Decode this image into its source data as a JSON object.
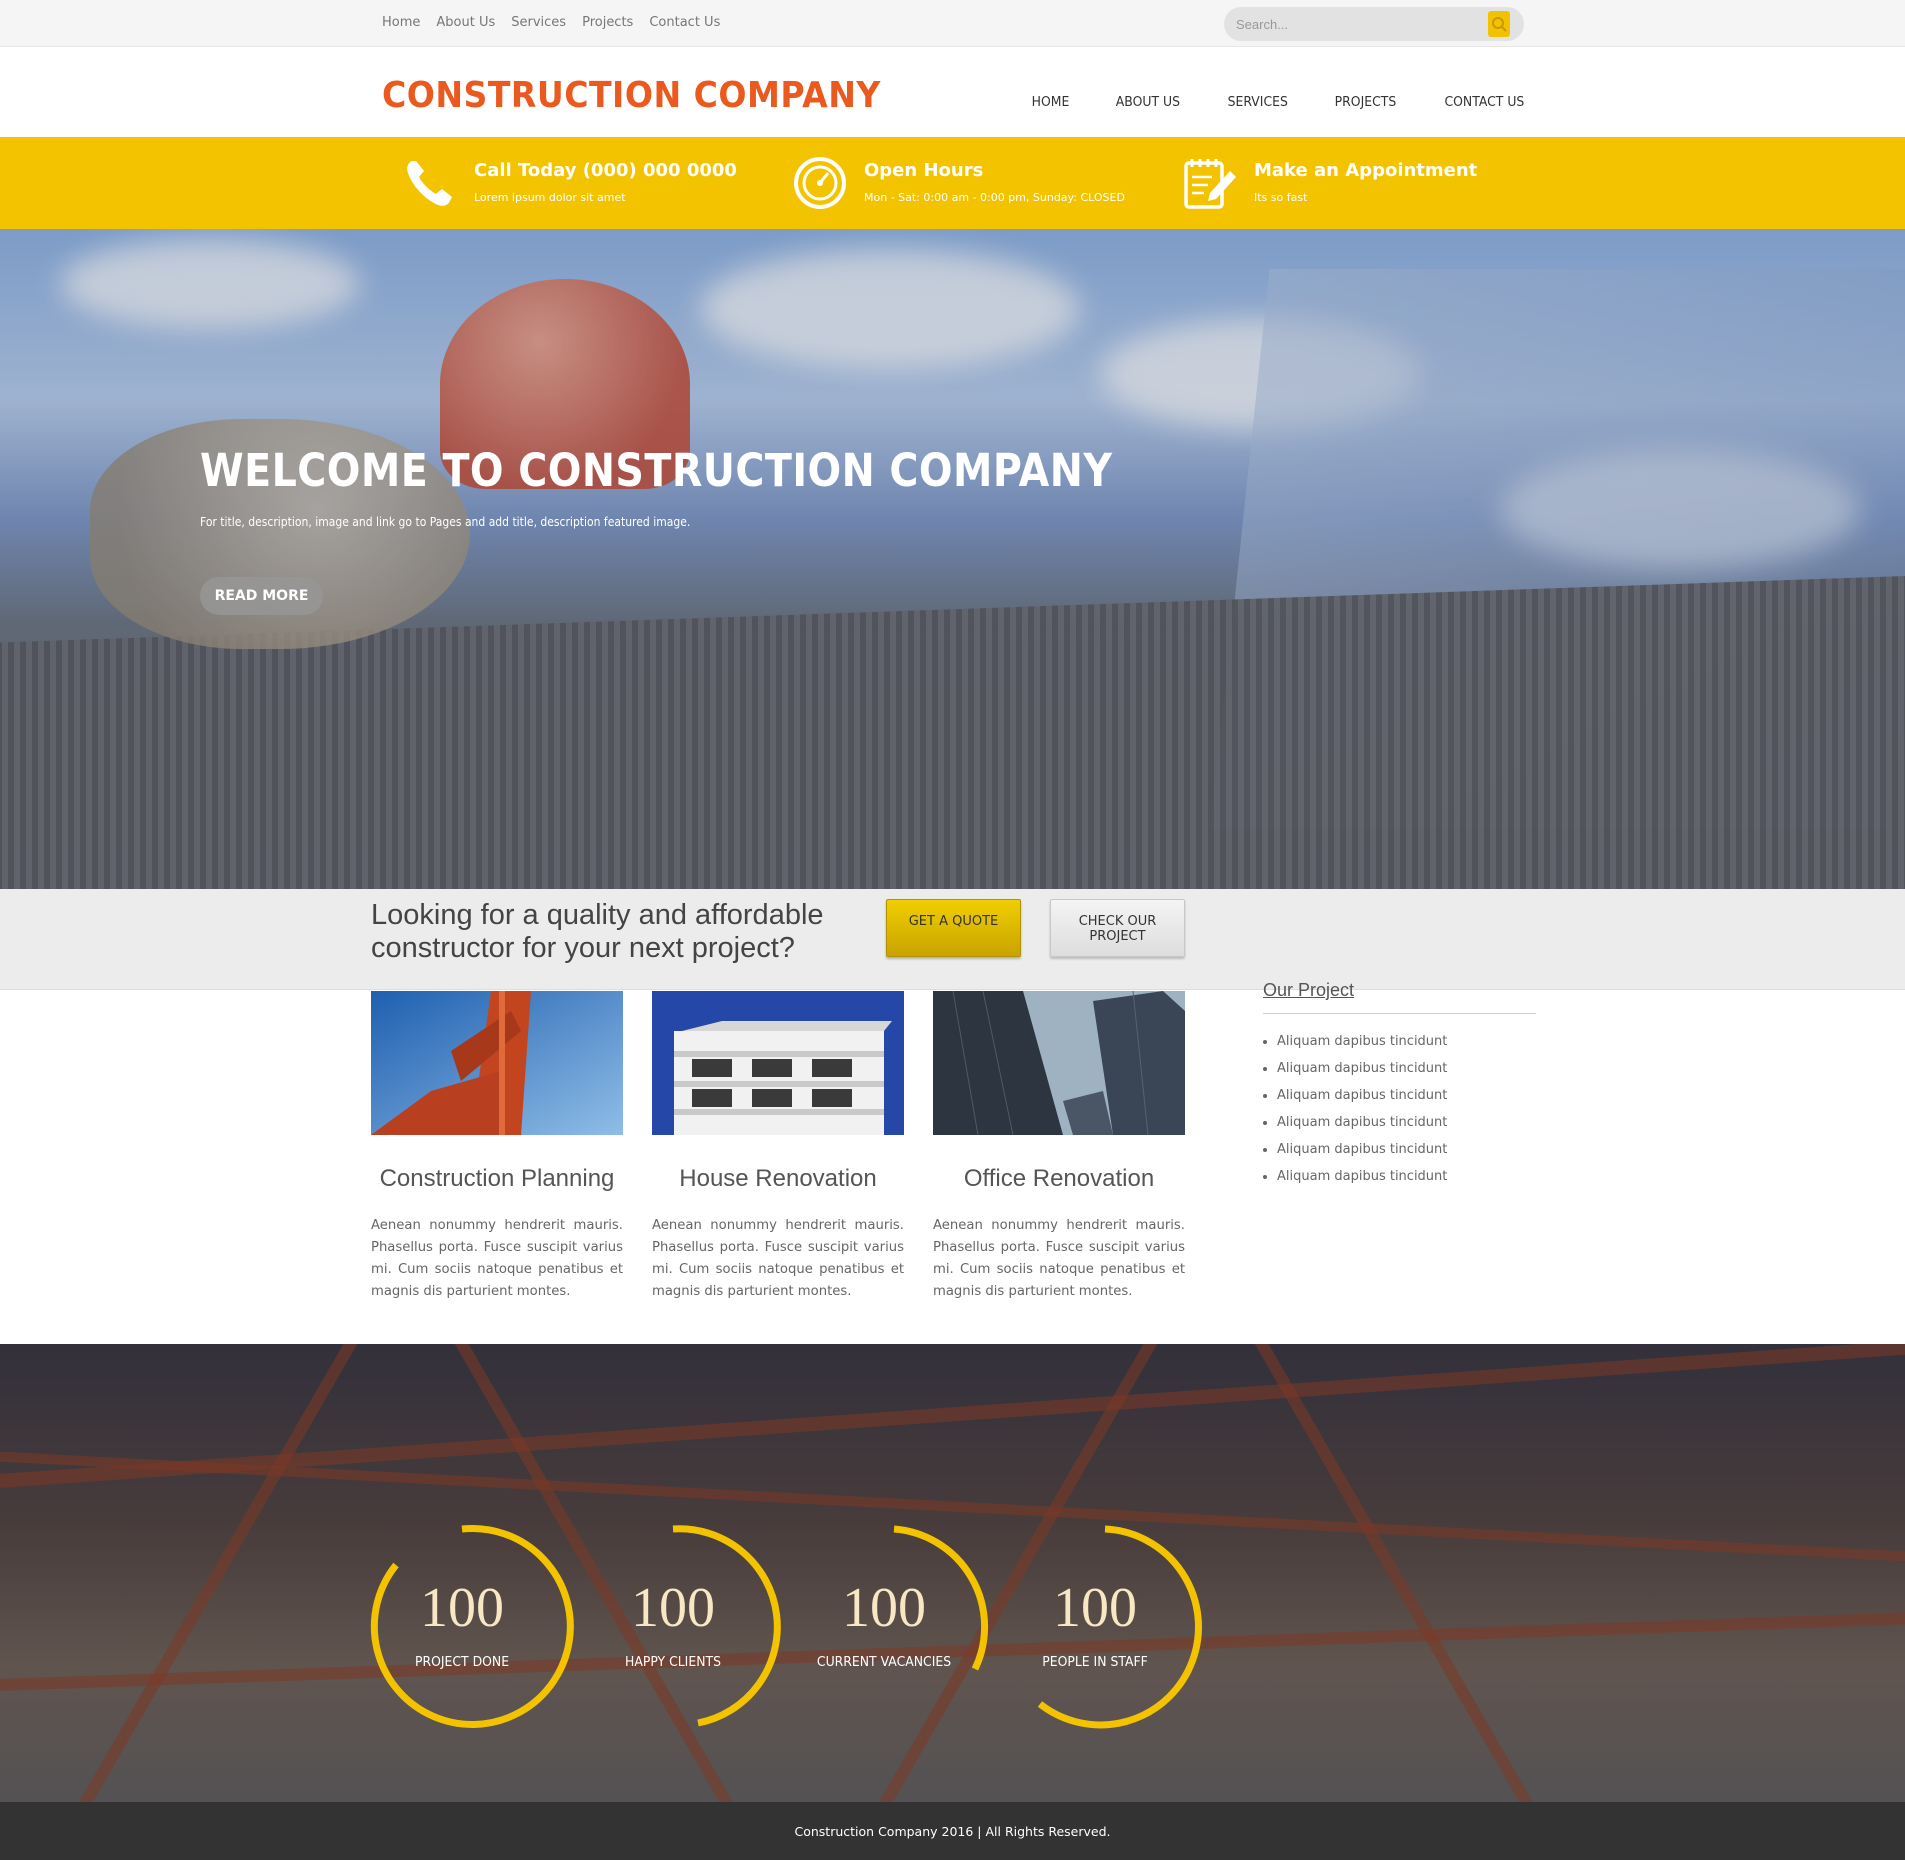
{
  "topbar": {
    "links": [
      "Home",
      "About Us",
      "Services",
      "Projects",
      "Contact Us"
    ],
    "search_placeholder": "Search...",
    "search_icon": "search-icon",
    "accent": "#f3c300"
  },
  "header": {
    "logo": "CONSTRUCTION COMPANY",
    "logo_color": "#ea5a1f",
    "nav": [
      "HOME",
      "ABOUT US",
      "SERVICES",
      "PROJECTS",
      "CONTACT US"
    ]
  },
  "infobar": {
    "items": [
      {
        "icon": "phone-icon",
        "title": "Call Today (000) 000 0000",
        "subtitle": "Lorem ipsum dolor sit amet"
      },
      {
        "icon": "clock-gauge-icon",
        "title": "Open Hours",
        "subtitle": "Mon - Sat: 0:00 am - 0:00 pm, Sunday: CLOSED"
      },
      {
        "icon": "notepad-pencil-icon",
        "title": "Make an Appointment",
        "subtitle": "Its so fast"
      }
    ]
  },
  "hero": {
    "title": "WELCOME TO CONSTRUCTION COMPANY",
    "text": "For title, description, image and link go to Pages and add title, description featured image.",
    "button": "READ MORE"
  },
  "cta": {
    "text": "Looking for a quality and affordable constructor for your next project?",
    "quote_button": "GET A QUOTE",
    "project_button": "CHECK OUR PROJECT"
  },
  "services": [
    {
      "image": "bridge-photo",
      "title": "Construction Planning",
      "text": "Aenean nonummy hendrerit mauris. Phasellus porta. Fusce suscipit varius mi. Cum sociis natoque penatibus et magnis dis parturient montes."
    },
    {
      "image": "house-photo",
      "title": "House Renovation",
      "text": "Aenean nonummy hendrerit mauris. Phasellus porta. Fusce suscipit varius mi. Cum sociis natoque penatibus et magnis dis parturient montes."
    },
    {
      "image": "office-towers-photo",
      "title": "Office Renovation",
      "text": "Aenean nonummy hendrerit mauris. Phasellus porta. Fusce suscipit varius mi. Cum sociis natoque penatibus et magnis dis parturient montes."
    }
  ],
  "sidebar": {
    "title": "Our Project",
    "items": [
      "Aliquam dapibus tincidunt",
      "Aliquam dapibus tincidunt",
      "Aliquam dapibus tincidunt",
      "Aliquam dapibus tincidunt",
      "Aliquam dapibus tincidunt",
      "Aliquam dapibus tincidunt"
    ]
  },
  "stats": [
    {
      "value": "100",
      "label": "PROJECT DONE"
    },
    {
      "value": "100",
      "label": "HAPPY CLIENTS"
    },
    {
      "value": "100",
      "label": "CURRENT VACANCIES"
    },
    {
      "value": "100",
      "label": "PEOPLE IN STAFF"
    }
  ],
  "footer": {
    "text": "Construction Company 2016 | All Rights Reserved."
  }
}
